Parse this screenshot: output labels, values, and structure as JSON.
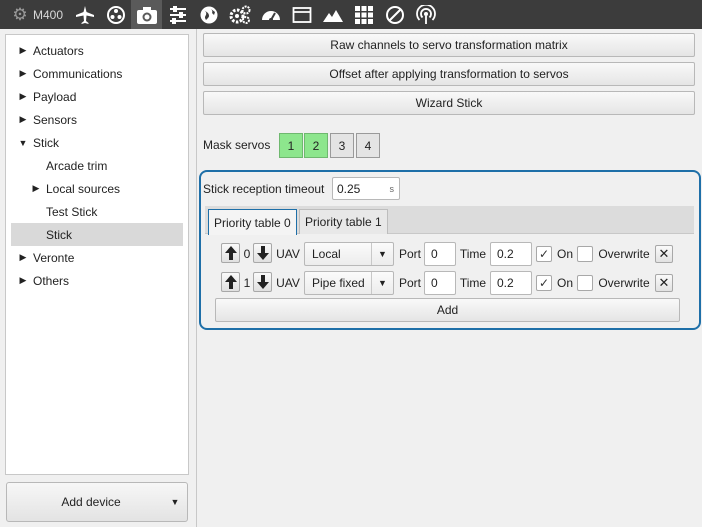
{
  "toolbar": {
    "device_name": "M400",
    "icons": [
      "gear-icon",
      "airplane-icon",
      "rotor-icon",
      "camera-icon",
      "sliders-icon",
      "globe-icon",
      "gears-icon",
      "gauge-icon",
      "window-icon",
      "mountain-icon",
      "grid-icon",
      "forbidden-icon",
      "broadcast-icon"
    ],
    "active_icon": "camera-icon"
  },
  "tree": {
    "items": [
      {
        "label": "Actuators",
        "expander": "collapsed",
        "level": 0
      },
      {
        "label": "Communications",
        "expander": "collapsed",
        "level": 0
      },
      {
        "label": "Payload",
        "expander": "collapsed",
        "level": 0
      },
      {
        "label": "Sensors",
        "expander": "collapsed",
        "level": 0
      },
      {
        "label": "Stick",
        "expander": "expanded",
        "level": 0
      },
      {
        "label": "Arcade trim",
        "expander": "none",
        "level": 1
      },
      {
        "label": "Local sources",
        "expander": "collapsed",
        "level": 1
      },
      {
        "label": "Test Stick",
        "expander": "none",
        "level": 1
      },
      {
        "label": "Stick",
        "expander": "none",
        "level": 1,
        "selected": true
      },
      {
        "label": "Veronte",
        "expander": "collapsed",
        "level": 0
      },
      {
        "label": "Others",
        "expander": "collapsed",
        "level": 0
      }
    ]
  },
  "add_device": {
    "label": "Add device"
  },
  "buttons": {
    "raw_channels": "Raw channels to servo transformation matrix",
    "offset": "Offset after applying transformation to servos",
    "wizard": "Wizard Stick"
  },
  "mask": {
    "label": "Mask servos",
    "servos": [
      {
        "label": "1",
        "enabled": true
      },
      {
        "label": "2",
        "enabled": true
      },
      {
        "label": "3",
        "enabled": false
      },
      {
        "label": "4",
        "enabled": false
      }
    ]
  },
  "timeout": {
    "label": "Stick reception timeout",
    "value": "0.25",
    "unit": "s"
  },
  "tabs": [
    {
      "label": "Priority table 0",
      "active": true
    },
    {
      "label": "Priority table 1",
      "active": false
    }
  ],
  "rows": [
    {
      "index": "0",
      "uav_label": "UAV",
      "source": "Local",
      "port_label": "Port",
      "port": "0",
      "time_label": "Time",
      "time": "0.2",
      "on_label": "On",
      "on": true,
      "overwrite_label": "Overwrite",
      "overwrite": false
    },
    {
      "index": "1",
      "uav_label": "UAV",
      "source": "Pipe fixed",
      "port_label": "Port",
      "port": "0",
      "time_label": "Time",
      "time": "0.2",
      "on_label": "On",
      "on": true,
      "overwrite_label": "Overwrite",
      "overwrite": false
    }
  ],
  "add_row": {
    "label": "Add"
  },
  "colors": {
    "toolbar": "#3c3c3c",
    "accent": "#1e6fa8",
    "servo_on": "#8de68d"
  }
}
